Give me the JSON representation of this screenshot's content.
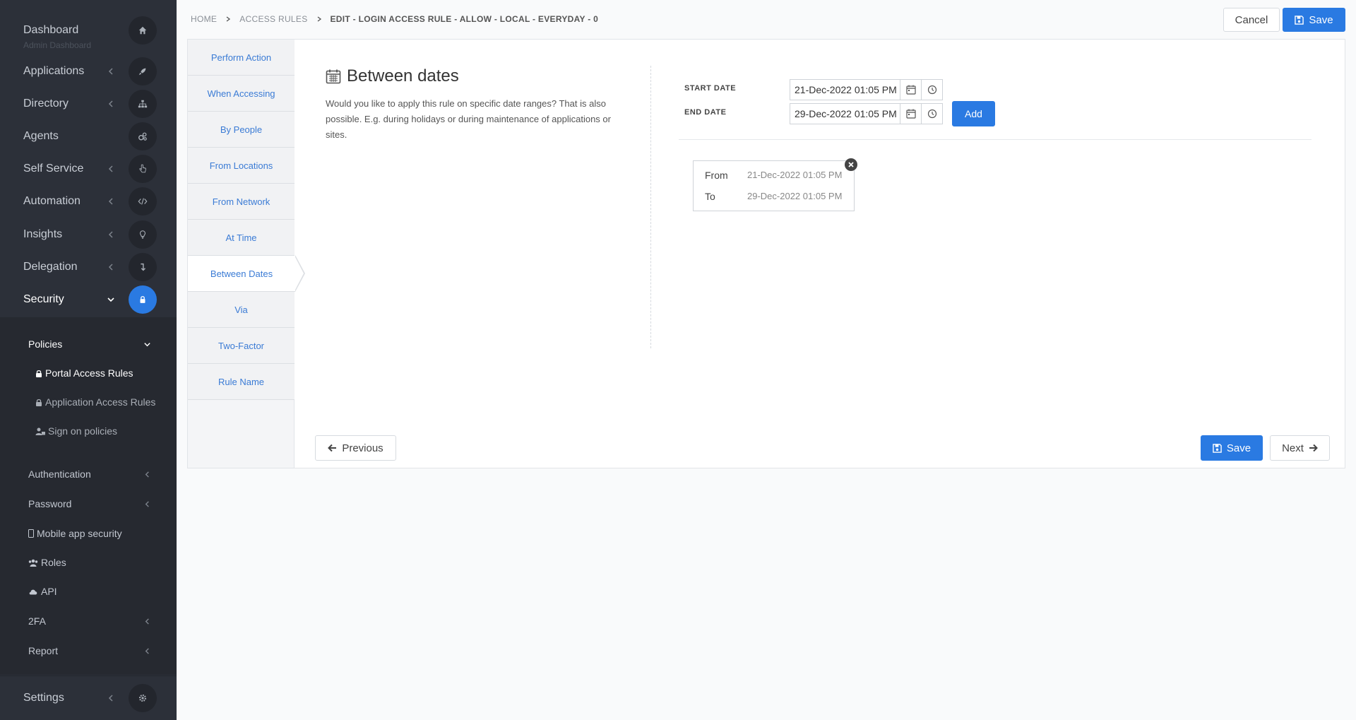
{
  "sidebar": {
    "dashboard": {
      "label": "Dashboard",
      "sub": "Admin Dashboard"
    },
    "items": [
      {
        "label": "Applications",
        "icon": "rocket-icon"
      },
      {
        "label": "Directory",
        "icon": "sitemap-icon"
      },
      {
        "label": "Agents",
        "icon": "cogs-icon"
      },
      {
        "label": "Self Service",
        "icon": "hand-pointer-icon"
      },
      {
        "label": "Automation",
        "icon": "code-icon"
      },
      {
        "label": "Insights",
        "icon": "lightbulb-icon"
      },
      {
        "label": "Delegation",
        "icon": "level-down-icon"
      },
      {
        "label": "Security",
        "icon": "lock-icon"
      }
    ],
    "security_sub": {
      "policies": "Policies",
      "portal_access_rules": "Portal Access Rules",
      "application_access_rules": "Application Access Rules",
      "sign_on_policies": "Sign on policies",
      "authentication": "Authentication",
      "password": "Password",
      "mobile_app_security": "Mobile app security",
      "roles": "Roles",
      "api": "API",
      "twofa": "2FA",
      "report": "Report"
    },
    "settings": "Settings"
  },
  "header": {
    "breadcrumb": [
      "HOME",
      "ACCESS RULES",
      "EDIT - LOGIN ACCESS RULE - ALLOW - LOCAL - EVERYDAY - 0"
    ],
    "cancel_label": "Cancel",
    "save_label": "Save"
  },
  "steps": [
    "Perform Action",
    "When Accessing",
    "By People",
    "From Locations",
    "From Network",
    "At Time",
    "Between Dates",
    "Via",
    "Two-Factor",
    "Rule Name"
  ],
  "active_step": "Between Dates",
  "section": {
    "title": "Between dates",
    "description": "Would you like to apply this rule on specific date ranges? That is also possible. E.g. during holidays or during maintenance of applications or sites."
  },
  "form": {
    "start_label": "START DATE",
    "start_value": "21-Dec-2022 01:05 PM",
    "end_label": "END DATE",
    "end_value": "29-Dec-2022 01:05 PM",
    "add_label": "Add"
  },
  "ranges": [
    {
      "from_label": "From",
      "from": "21-Dec-2022 01:05 PM",
      "to_label": "To",
      "to": "29-Dec-2022 01:05 PM"
    }
  ],
  "footer": {
    "previous_label": "Previous",
    "save_label": "Save",
    "next_label": "Next"
  },
  "colors": {
    "primary": "#2a7ae2",
    "sidebar": "#2c3039",
    "link": "#3a7bd5"
  }
}
